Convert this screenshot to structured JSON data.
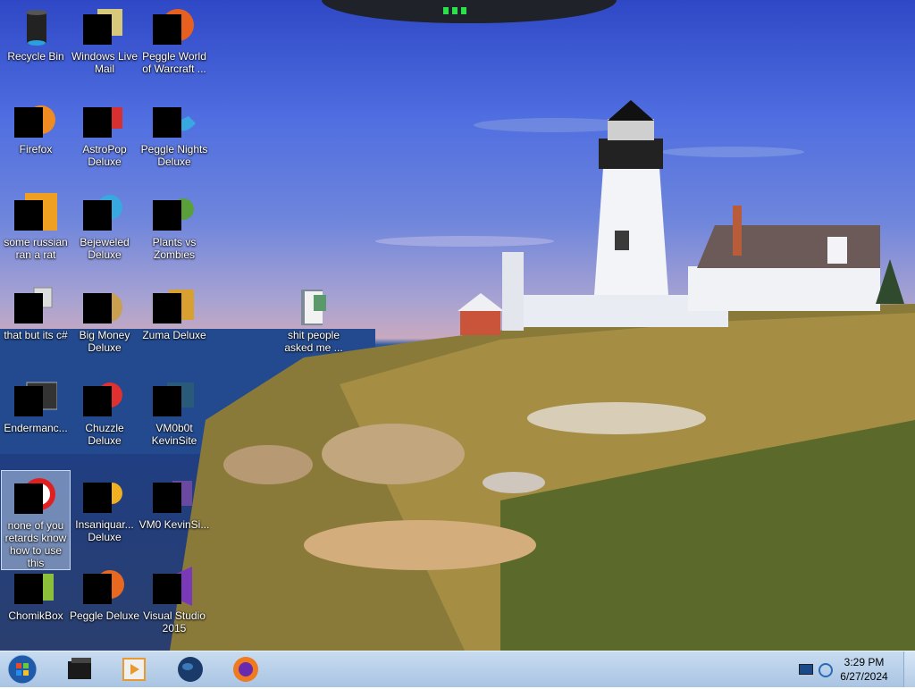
{
  "desktop_icons": [
    {
      "label": "Recycle Bin",
      "icon": "recycle-bin-icon"
    },
    {
      "label": "Windows Live Mail",
      "icon": "mail-icon"
    },
    {
      "label": "Peggle World of Warcraft ...",
      "icon": "peggle-icon"
    },
    {
      "label": "Firefox",
      "icon": "firefox-icon"
    },
    {
      "label": "AstroPop Deluxe",
      "icon": "astropop-icon"
    },
    {
      "label": "Peggle Nights Deluxe",
      "icon": "peggle-nights-icon"
    },
    {
      "label": "some russian ran a rat",
      "icon": "text-file-icon"
    },
    {
      "label": "Bejeweled Deluxe",
      "icon": "bejeweled-icon"
    },
    {
      "label": "Plants vs Zombies",
      "icon": "plants-vs-zombies-icon"
    },
    {
      "label": "that but its c#",
      "icon": "document-stack-icon"
    },
    {
      "label": "Big Money Deluxe",
      "icon": "money-bag-icon"
    },
    {
      "label": "Zuma Deluxe",
      "icon": "zuma-icon"
    },
    {
      "label": "shit people asked me ...",
      "icon": "folder-icon"
    },
    {
      "label": "Endermanc...",
      "icon": "console-icon"
    },
    {
      "label": "Chuzzle Deluxe",
      "icon": "chuzzle-icon"
    },
    {
      "label": "VM0b0t KevinSite",
      "icon": "vm-icon"
    },
    {
      "label": "none of you retards know how to use this",
      "icon": "app-icon"
    },
    {
      "label": "Insaniquar... Deluxe",
      "icon": "insaniquarium-icon"
    },
    {
      "label": "VM0 KevinSi...",
      "icon": "vm-icon"
    },
    {
      "label": "ChomikBox",
      "icon": "chomikbox-icon"
    },
    {
      "label": "Peggle Deluxe",
      "icon": "peggle-deluxe-icon"
    },
    {
      "label": "Visual Studio 2015",
      "icon": "visual-studio-icon"
    }
  ],
  "taskbar": {
    "pinned": [
      {
        "icon": "start-orb-icon"
      },
      {
        "icon": "terminal-icon"
      },
      {
        "icon": "media-player-icon"
      },
      {
        "icon": "globe-icon"
      },
      {
        "icon": "firefox-icon"
      }
    ],
    "tray": {
      "time": "3:29 PM",
      "date": "6/27/2024"
    }
  },
  "colors": {
    "taskbar": "#b9d1ec",
    "topbar": "#1f2228",
    "indicator": "#2be04a"
  }
}
